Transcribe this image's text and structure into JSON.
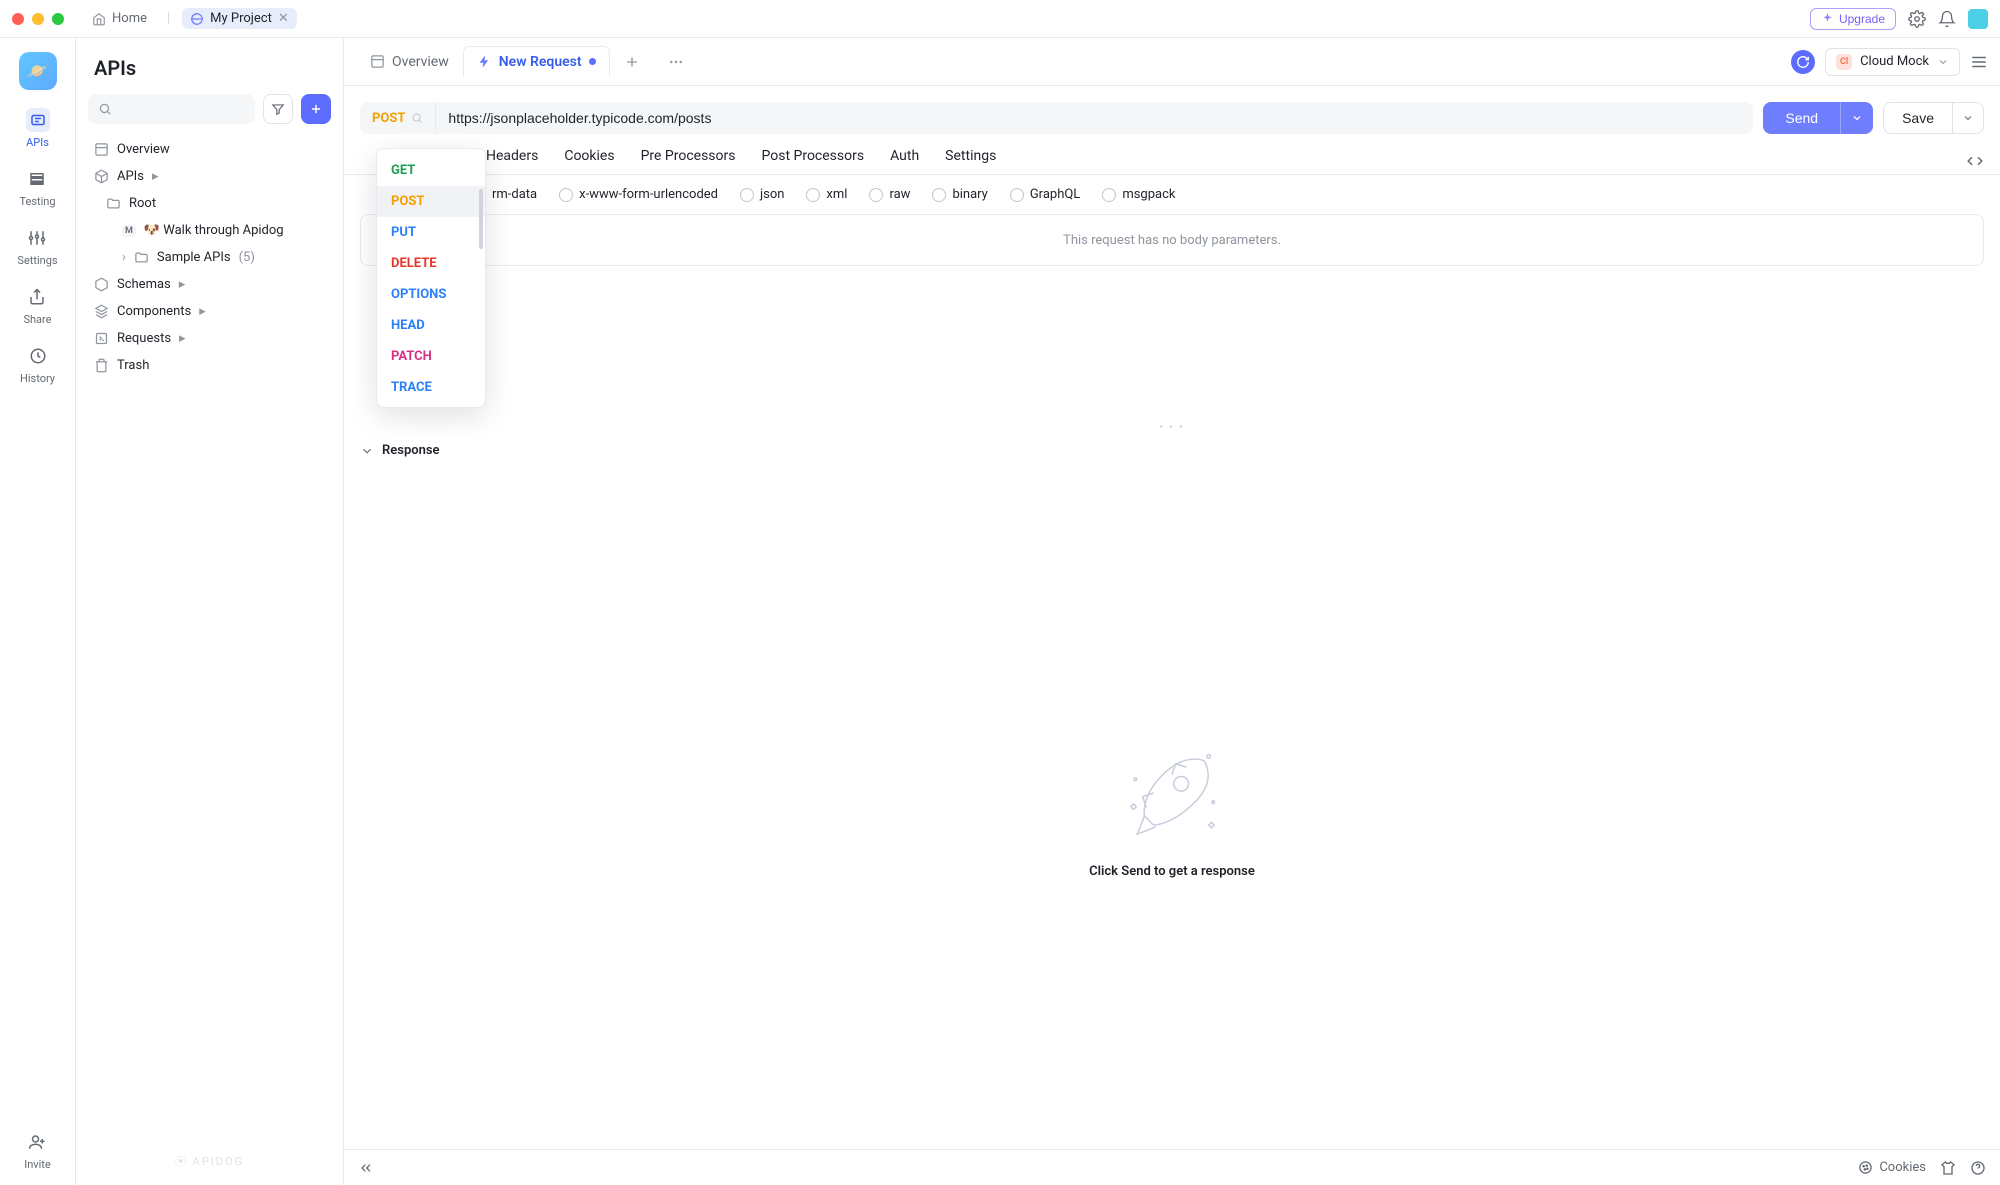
{
  "titlebar": {
    "home_label": "Home",
    "project_name": "My Project",
    "upgrade_label": "Upgrade"
  },
  "nav": {
    "items": [
      {
        "label": "APIs"
      },
      {
        "label": "Testing"
      },
      {
        "label": "Settings"
      },
      {
        "label": "Share"
      },
      {
        "label": "History"
      },
      {
        "label": "Invite"
      }
    ]
  },
  "sidebar": {
    "title": "APIs",
    "overview_label": "Overview",
    "apis_label": "APIs",
    "root_label": "Root",
    "walkthrough_label": "🐶 Walk through Apidog",
    "sample_label": "Sample APIs",
    "sample_count": "(5)",
    "schemas_label": "Schemas",
    "components_label": "Components",
    "requests_label": "Requests",
    "trash_label": "Trash",
    "footer": "⦿ APIDOG"
  },
  "main_tabs": {
    "overview": "Overview",
    "new_request": "New Request",
    "cloud_mock": "Cloud Mock",
    "cloud_initials": "Cl"
  },
  "request": {
    "method": "POST",
    "url": "https://jsonplaceholder.typicode.com/posts",
    "send_label": "Send",
    "save_label": "Save",
    "methods": [
      {
        "name": "GET",
        "color": "#1f9e55"
      },
      {
        "name": "POST",
        "color": "#f59f00"
      },
      {
        "name": "PUT",
        "color": "#2d7ff9"
      },
      {
        "name": "DELETE",
        "color": "#e8362d"
      },
      {
        "name": "OPTIONS",
        "color": "#2d7ff9"
      },
      {
        "name": "HEAD",
        "color": "#2d7ff9"
      },
      {
        "name": "PATCH",
        "color": "#d63384"
      },
      {
        "name": "TRACE",
        "color": "#2d7ff9"
      }
    ]
  },
  "subtabs": [
    "Headers",
    "Cookies",
    "Pre Processors",
    "Post Processors",
    "Auth",
    "Settings"
  ],
  "body_types": [
    "rm-data",
    "x-www-form-urlencoded",
    "json",
    "xml",
    "raw",
    "binary",
    "GraphQL",
    "msgpack"
  ],
  "body_empty_msg": "This request has no body parameters.",
  "response": {
    "title": "Response",
    "hint": "Click Send to get a response"
  },
  "status_bar": {
    "cookies": "Cookies"
  }
}
